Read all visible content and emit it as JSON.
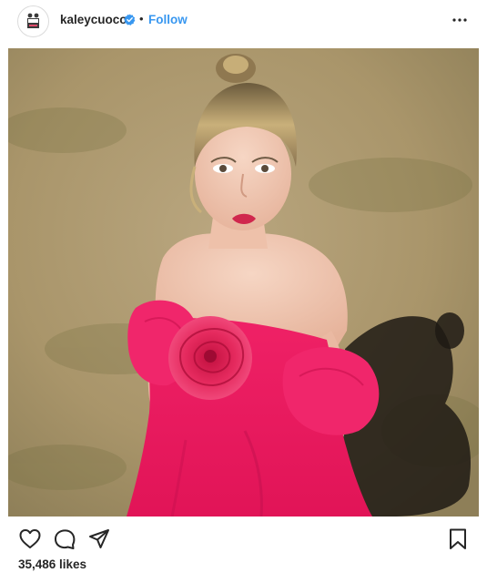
{
  "post": {
    "username": "kaleycuoco",
    "separator": "•",
    "follow_label": "Follow",
    "likes_text": "35,486 likes"
  },
  "icons": {
    "avatar": "avatar-logo",
    "verified": "verified-badge-icon",
    "more": "more-options-icon",
    "like": "heart-icon",
    "comment": "comment-icon",
    "share": "share-icon",
    "save": "bookmark-icon"
  },
  "colors": {
    "link_blue": "#3897f0",
    "verified_blue": "#3897f0",
    "text": "#262626",
    "dress_pink": "#e8185f"
  }
}
